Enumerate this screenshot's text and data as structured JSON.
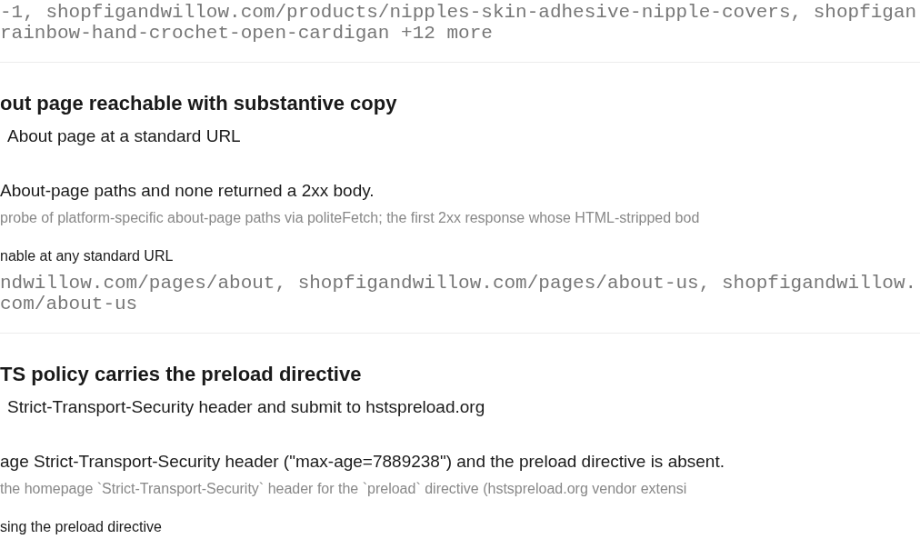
{
  "sections": [
    {
      "evidence": [
        "-1, shopfigandwillow.com/products/nipples-skin-adhesive-nipple-covers, shopfigan",
        "rainbow-hand-crochet-open-cardigan +12 more"
      ]
    },
    {
      "title": "out page reachable with substantive copy",
      "fix": "About page at a standard URL",
      "finding": "About-page paths and none returned a 2xx body.",
      "method": "probe of platform-specific about-page paths via politeFetch; the first 2xx response whose HTML-stripped bod",
      "evidence_label": "nable at any standard URL",
      "evidence": [
        "ndwillow.com/pages/about, shopfigandwillow.com/pages/about-us, shopfigandwillow.",
        "com/about-us"
      ]
    },
    {
      "title": "TS policy carries the preload directive",
      "fix": "Strict-Transport-Security header and submit to hstspreload.org",
      "finding": "age Strict-Transport-Security header (\"max-age=7889238\") and the preload directive is absent.",
      "method": "the homepage `Strict-Transport-Security` header for the `preload` directive (hstspreload.org vendor extensi",
      "evidence_label": "sing the preload directive"
    }
  ]
}
